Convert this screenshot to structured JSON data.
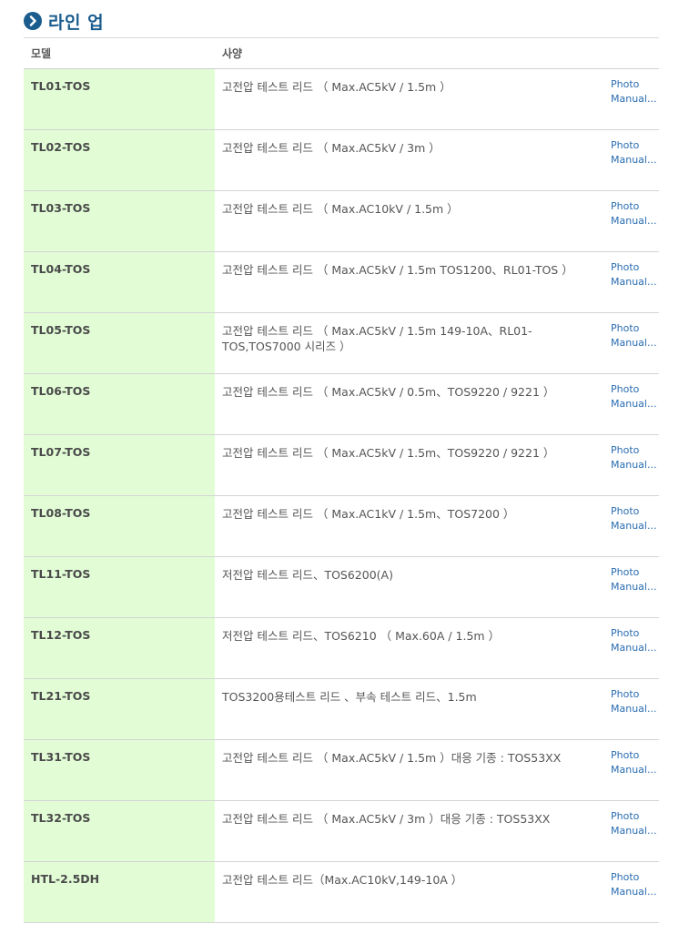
{
  "section": {
    "title": "라인 업",
    "icon": "chevron-right-circle-icon",
    "accent_color": "#1a5c8e"
  },
  "table": {
    "headers": {
      "model": "모델",
      "spec": "사양"
    },
    "model_cell_color": "#e2fdd6",
    "rows": [
      {
        "model": "TL01-TOS",
        "spec": "고전압 테스트 리드 （ Max.AC5kV / 1.5m ）",
        "photo": "Photo",
        "manual": "Manual..."
      },
      {
        "model": "TL02-TOS",
        "spec": "고전압 테스트 리드 （ Max.AC5kV / 3m ）",
        "photo": "Photo",
        "manual": "Manual..."
      },
      {
        "model": "TL03-TOS",
        "spec": "고전압 테스트 리드 （ Max.AC10kV / 1.5m ）",
        "photo": "Photo",
        "manual": "Manual..."
      },
      {
        "model": "TL04-TOS",
        "spec": "고전압 테스트 리드 （ Max.AC5kV / 1.5m TOS1200、RL01-TOS ）",
        "photo": "Photo",
        "manual": "Manual..."
      },
      {
        "model": "TL05-TOS",
        "spec": "고전압 테스트 리드 （ Max.AC5kV / 1.5m 149-10A、RL01-TOS,TOS7000 시리즈 ）",
        "photo": "Photo",
        "manual": "Manual..."
      },
      {
        "model": "TL06-TOS",
        "spec": "고전압 테스트 리드 （ Max.AC5kV / 0.5m、TOS9220 / 9221 ）",
        "photo": "Photo",
        "manual": "Manual..."
      },
      {
        "model": "TL07-TOS",
        "spec": "고전압 테스트 리드 （ Max.AC5kV / 1.5m、TOS9220 / 9221 ）",
        "photo": "Photo",
        "manual": "Manual..."
      },
      {
        "model": "TL08-TOS",
        "spec": "고전압 테스트 리드 （ Max.AC1kV / 1.5m、TOS7200 ）",
        "photo": "Photo",
        "manual": "Manual..."
      },
      {
        "model": "TL11-TOS",
        "spec": "저전압 테스트 리드、TOS6200(A)",
        "photo": "Photo",
        "manual": "Manual..."
      },
      {
        "model": "TL12-TOS",
        "spec": "저전압 테스트 리드、TOS6210 （ Max.60A / 1.5m ）",
        "photo": "Photo",
        "manual": "Manual..."
      },
      {
        "model": "TL21-TOS",
        "spec": "TOS3200용테스트 리드 、부속 테스트 리드、1.5m",
        "photo": "Photo",
        "manual": "Manual..."
      },
      {
        "model": "TL31-TOS",
        "spec": "고전압 테스트 리드 （ Max.AC5kV / 1.5m ）대응 기종 : TOS53XX",
        "photo": "Photo",
        "manual": "Manual..."
      },
      {
        "model": "TL32-TOS",
        "spec": "고전압 테스트 리드 （ Max.AC5kV / 3m ）대응 기종 : TOS53XX",
        "photo": "Photo",
        "manual": "Manual..."
      },
      {
        "model": "HTL-2.5DH",
        "spec": "고전압 테스트 리드（Max.AC10kV,149-10A ）",
        "photo": "Photo",
        "manual": "Manual..."
      }
    ]
  }
}
